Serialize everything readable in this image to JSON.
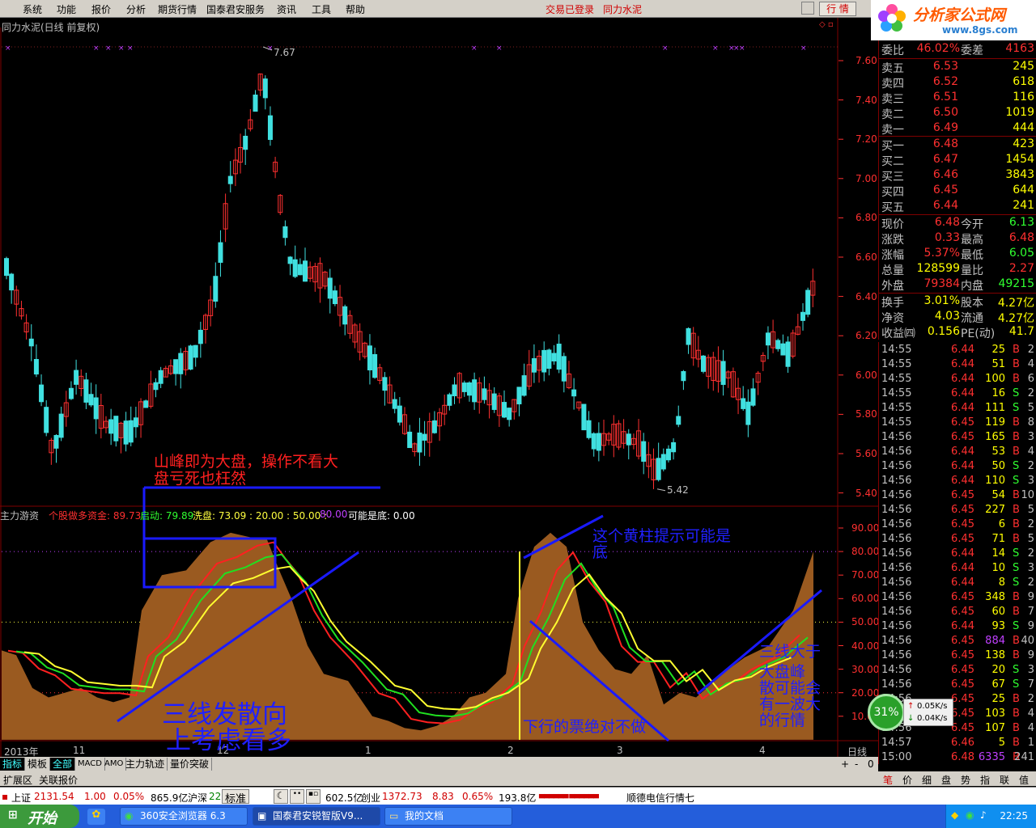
{
  "menu": {
    "items": [
      "系统",
      "功能",
      "报价",
      "分析",
      "期货行情",
      "国泰君安服务",
      "资讯",
      "工具",
      "帮助"
    ],
    "status_login": "交易已登录",
    "status_stock": "同力水泥",
    "hq_button": "行 情"
  },
  "logo": {
    "title": "分析家公式网",
    "url_text": "www.8gs.com"
  },
  "chart": {
    "title": "同力水泥(日线 前复权)",
    "high_label": "7.67",
    "low_label": "5.42",
    "price_axis": [
      "7.60",
      "7.40",
      "7.20",
      "7.00",
      "6.80",
      "6.60",
      "6.40",
      "6.20",
      "6.00",
      "5.80",
      "5.60",
      "5.40"
    ],
    "indicator_axis": [
      "90.00",
      "80.00",
      "70.00",
      "60.00",
      "50.00",
      "40.00",
      "30.00",
      "20.00",
      "10.00"
    ],
    "indicator_name": "主力游资",
    "legend": [
      {
        "text": "个股做多资金: 89.73",
        "color": "#ff3030"
      },
      {
        "text": "启动: 79.89",
        "color": "#30ff30"
      },
      {
        "text": "洗盘: 73.09 : 20.00 : 50.00 :",
        "color": "#ffff40"
      },
      {
        "text": "80.00",
        "color": "#c040ff"
      },
      {
        "text": "可能是底: 0.00",
        "color": "#ffffff"
      }
    ],
    "date_axis": [
      "2013年",
      "11",
      "12",
      "1",
      "2",
      "3",
      "4"
    ],
    "period": "日线",
    "annotations": {
      "peak_note_line1": "山峰即为大盘，操作不看大",
      "peak_note_line2": "盘亏死也枉然",
      "diverge_line1": "三线发散向",
      "diverge_line2": "上考虑看多",
      "yellow_bar_line1": "这个黄柱提示可能是",
      "yellow_bar_line2": "底",
      "down_note": "下行的票绝对不做",
      "right_note_line1": "三线大于",
      "right_note_line2": "大盘峰",
      "right_note_line3": "散可能会",
      "right_note_line4": "有一波大",
      "right_note_line5": "的行情"
    }
  },
  "chart_data": {
    "type": "candlestick",
    "price_axis_ticks": [
      7.6,
      7.4,
      7.2,
      7.0,
      6.8,
      6.6,
      6.4,
      6.2,
      6.0,
      5.8,
      5.6,
      5.4
    ],
    "max_price": 7.67,
    "min_price": 5.42,
    "indicator_ticks": [
      90,
      80,
      70,
      60,
      50,
      40,
      30,
      20,
      10
    ],
    "indicator_values": {
      "个股做多资金": 89.73,
      "启动": 79.89,
      "洗盘": 73.09,
      "可能是底": 0.0
    },
    "reference_levels": [
      20,
      50,
      80
    ]
  },
  "quote": {
    "weibi_label": "委比",
    "weibi": "46.02%",
    "weicha_label": "委差",
    "weicha": "4163",
    "sell": [
      {
        "name": "卖五",
        "price": "6.53",
        "vol": "245"
      },
      {
        "name": "卖四",
        "price": "6.52",
        "vol": "618"
      },
      {
        "name": "卖三",
        "price": "6.51",
        "vol": "116"
      },
      {
        "name": "卖二",
        "price": "6.50",
        "vol": "1019"
      },
      {
        "name": "卖一",
        "price": "6.49",
        "vol": "444"
      }
    ],
    "buy": [
      {
        "name": "买一",
        "price": "6.48",
        "vol": "423"
      },
      {
        "name": "买二",
        "price": "6.47",
        "vol": "1454"
      },
      {
        "name": "买三",
        "price": "6.46",
        "vol": "3843"
      },
      {
        "name": "买四",
        "price": "6.45",
        "vol": "644"
      },
      {
        "name": "买五",
        "price": "6.44",
        "vol": "241"
      }
    ],
    "stats": [
      {
        "k1": "现价",
        "v1": "6.48",
        "c1": "#ff3030",
        "k2": "今开",
        "v2": "6.13",
        "c2": "#30ff30"
      },
      {
        "k1": "涨跌",
        "v1": "0.33",
        "c1": "#ff3030",
        "k2": "最高",
        "v2": "6.48",
        "c2": "#ff3030"
      },
      {
        "k1": "涨幅",
        "v1": "5.37%",
        "c1": "#ff3030",
        "k2": "最低",
        "v2": "6.05",
        "c2": "#30ff30"
      },
      {
        "k1": "总量",
        "v1": "128599",
        "c1": "#ffff00",
        "k2": "量比",
        "v2": "2.27",
        "c2": "#ff3030"
      },
      {
        "k1": "外盘",
        "v1": "79384",
        "c1": "#ff3030",
        "k2": "内盘",
        "v2": "49215",
        "c2": "#30ff30"
      }
    ],
    "stats2": [
      {
        "k1": "换手",
        "v1": "3.01%",
        "c1": "#ffff00",
        "k2": "股本",
        "v2": "4.27亿",
        "c2": "#ffff00"
      },
      {
        "k1": "净资",
        "v1": "4.03",
        "c1": "#ffff00",
        "k2": "流通",
        "v2": "4.27亿",
        "c2": "#ffff00"
      },
      {
        "k1": "收益㈣",
        "v1": "0.156",
        "c1": "#ffff00",
        "k2": "PE(动)",
        "v2": "41.7",
        "c2": "#ffff00"
      }
    ]
  },
  "ticks": [
    {
      "t": "14:55",
      "p": "6.44",
      "v": "25",
      "bs": "B",
      "n": "2"
    },
    {
      "t": "14:55",
      "p": "6.44",
      "v": "51",
      "bs": "B",
      "n": "4"
    },
    {
      "t": "14:55",
      "p": "6.44",
      "v": "100",
      "bs": "B",
      "n": "6"
    },
    {
      "t": "14:55",
      "p": "6.44",
      "v": "16",
      "bs": "S",
      "n": "2"
    },
    {
      "t": "14:55",
      "p": "6.44",
      "v": "111",
      "bs": "S",
      "n": "5"
    },
    {
      "t": "14:55",
      "p": "6.45",
      "v": "119",
      "bs": "B",
      "n": "8"
    },
    {
      "t": "14:56",
      "p": "6.45",
      "v": "165",
      "bs": "B",
      "n": "3"
    },
    {
      "t": "14:56",
      "p": "6.44",
      "v": "53",
      "bs": "B",
      "n": "4"
    },
    {
      "t": "14:56",
      "p": "6.44",
      "v": "50",
      "bs": "S",
      "n": "2"
    },
    {
      "t": "14:56",
      "p": "6.44",
      "v": "110",
      "bs": "S",
      "n": "3"
    },
    {
      "t": "14:56",
      "p": "6.45",
      "v": "54",
      "bs": "B",
      "n": "10"
    },
    {
      "t": "14:56",
      "p": "6.45",
      "v": "227",
      "bs": "B",
      "n": "5"
    },
    {
      "t": "14:56",
      "p": "6.45",
      "v": "6",
      "bs": "B",
      "n": "2"
    },
    {
      "t": "14:56",
      "p": "6.45",
      "v": "71",
      "bs": "B",
      "n": "5"
    },
    {
      "t": "14:56",
      "p": "6.44",
      "v": "14",
      "bs": "S",
      "n": "2"
    },
    {
      "t": "14:56",
      "p": "6.44",
      "v": "10",
      "bs": "S",
      "n": "3"
    },
    {
      "t": "14:56",
      "p": "6.44",
      "v": "8",
      "bs": "S",
      "n": "2"
    },
    {
      "t": "14:56",
      "p": "6.45",
      "v": "348",
      "bs": "B",
      "n": "9"
    },
    {
      "t": "14:56",
      "p": "6.45",
      "v": "60",
      "bs": "B",
      "n": "7"
    },
    {
      "t": "14:56",
      "p": "6.44",
      "v": "93",
      "bs": "S",
      "n": "9"
    },
    {
      "t": "14:56",
      "p": "6.45",
      "v": "884",
      "bs": "B",
      "n": "40",
      "hl": true
    },
    {
      "t": "14:56",
      "p": "6.45",
      "v": "138",
      "bs": "B",
      "n": "9"
    },
    {
      "t": "14:56",
      "p": "6.45",
      "v": "20",
      "bs": "S",
      "n": "3"
    },
    {
      "t": "14:56",
      "p": "6.45",
      "v": "67",
      "bs": "S",
      "n": "7"
    },
    {
      "t": "14:56",
      "p": "6.45",
      "v": "25",
      "bs": "B",
      "n": "2"
    },
    {
      "t": "14:56",
      "p": "6.45",
      "v": "103",
      "bs": "B",
      "n": "4"
    },
    {
      "t": "14:56",
      "p": "6.45",
      "v": "107",
      "bs": "B",
      "n": "4"
    },
    {
      "t": "14:57",
      "p": "6.46",
      "v": "5",
      "bs": "B",
      "n": "1"
    },
    {
      "t": "15:00",
      "p": "6.48",
      "v": "6335",
      "bs": "B",
      "n": "241",
      "hl2": true
    }
  ],
  "speed": {
    "percent": "31%",
    "up": "0.05K/s",
    "down": "0.04K/s"
  },
  "right_tabs": [
    "笔",
    "价",
    "细",
    "盘",
    "势",
    "指",
    "联",
    "值"
  ],
  "tabs": [
    "指标",
    "模板",
    "全部",
    "MACD",
    "AMO",
    "主力轨迹",
    "量价突破"
  ],
  "tabs_right": [
    "+",
    "-",
    "0"
  ],
  "tabbar2": [
    "扩展区",
    "关联报价"
  ],
  "index_bar": {
    "sh_label": "上证",
    "sh_value": "2131.54",
    "sh_change": "1.00",
    "sh_pct": "0.05%",
    "sh_amount": "865.9亿",
    "sz_label": "沪深",
    "sz_value": "22",
    "mode": "标准",
    "amount2": "602.5亿",
    "cy_label": "创业",
    "cy_value": "1372.73",
    "cy_change": "8.83",
    "cy_pct": "0.65%",
    "cy_amount": "193.8亿",
    "news": "顺德电信行情七"
  },
  "taskbar": {
    "start": "开始",
    "items": [
      "360安全浏览器 6.3",
      "国泰君安锐智版V9...",
      "我的文档"
    ],
    "clock": "22:25"
  }
}
